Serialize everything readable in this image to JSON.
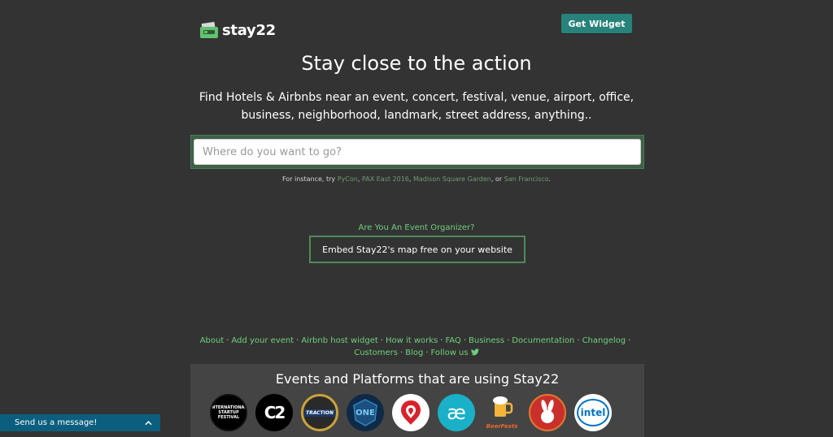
{
  "header": {
    "logo_text": "stay22",
    "get_widget_label": "Get Widget"
  },
  "hero": {
    "title": "Stay close to the action",
    "subtitle": "Find Hotels & Airbnbs near an event, concert, festival, venue, airport, office, business, neighborhood, landmark, street address, anything.."
  },
  "search": {
    "placeholder": "Where do you want to go?",
    "value": ""
  },
  "examples": {
    "prefix": "For instance, try",
    "links": [
      "PyCon",
      "PAX East 2016",
      "Madison Square Garden",
      "San Francisco"
    ],
    "sep1": ",",
    "sep2": ",",
    "sep3": ", or",
    "suffix": "."
  },
  "organizer": {
    "question": "Are You An Event Organizer?",
    "embed_label": "Embed Stay22's map free on your website"
  },
  "footer": {
    "links": [
      "About",
      "Add your event",
      "Airbnb host widget",
      "How it works",
      "FAQ",
      "Business",
      "Documentation",
      "Changelog",
      "Customers",
      "Blog",
      "Follow us"
    ],
    "separator": "·"
  },
  "events": {
    "title": "Events and Platforms that are using Stay22",
    "logos": [
      {
        "icon": "startup-festival-logo",
        "text": "INTERNATIONAL STARTUP FESTIVAL"
      },
      {
        "icon": "c2-logo",
        "text": "C2"
      },
      {
        "icon": "traction-logo",
        "text": "TRACTION"
      },
      {
        "icon": "esl-one-logo",
        "text": "ONE"
      },
      {
        "icon": "red-pin-logo",
        "text": ""
      },
      {
        "icon": "ae-logo",
        "text": "æ"
      },
      {
        "icon": "beerfests-logo",
        "text": "BeerFests"
      },
      {
        "icon": "rabbit-logo",
        "text": ""
      },
      {
        "icon": "intel-logo",
        "text": "intel"
      }
    ]
  },
  "chat": {
    "label": "Send us a message!"
  },
  "colors": {
    "background": "#333333",
    "accent_teal": "#26827a",
    "link_green": "#6fd07c",
    "chat_blue": "#0b5e7d"
  }
}
